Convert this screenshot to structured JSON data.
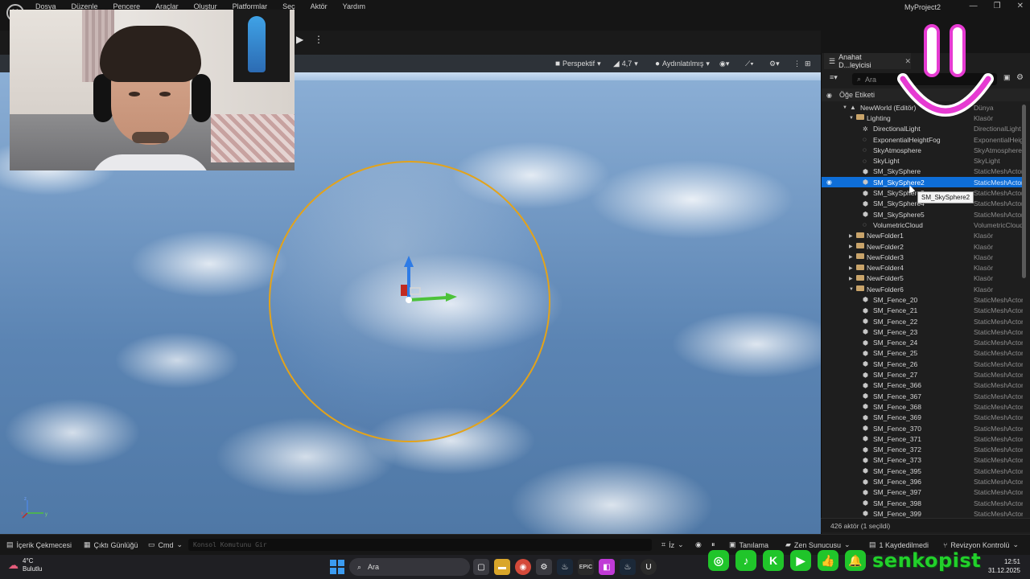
{
  "menubar": {
    "items": [
      "Dosya",
      "Düzenle",
      "Pencere",
      "Araçlar",
      "Oluştur",
      "Platformlar",
      "Seç",
      "Aktör",
      "Yardım"
    ],
    "project_name": "MyProject2"
  },
  "viewport": {
    "perspective_label": "Perspektif",
    "fov_value": "4,7",
    "lighting_label": "Aydınlatılmış",
    "axis_labels": [
      "z",
      "x",
      "y"
    ]
  },
  "outliner": {
    "tab_label": "Anahat D...leyicisi",
    "search_placeholder": "Ara",
    "header_label": "Öğe Etiketi",
    "rows": [
      {
        "label": "NewWorld (Editör)",
        "type": "Dünya",
        "depth": 0,
        "kind": "world",
        "expanded": true
      },
      {
        "label": "Lighting",
        "type": "Klasör",
        "depth": 1,
        "kind": "folder",
        "expanded": true
      },
      {
        "label": "DirectionalLight",
        "type": "DirectionalLight",
        "depth": 2,
        "kind": "light"
      },
      {
        "label": "ExponentialHeightFog",
        "type": "ExponentialHeightFog",
        "depth": 2,
        "kind": "actor"
      },
      {
        "label": "SkyAtmosphere",
        "type": "SkyAtmosphere",
        "depth": 2,
        "kind": "actor"
      },
      {
        "label": "SkyLight",
        "type": "SkyLight",
        "depth": 2,
        "kind": "actor"
      },
      {
        "label": "SM_SkySphere",
        "type": "StaticMeshActor",
        "depth": 2,
        "kind": "mesh"
      },
      {
        "label": "SM_SkySphere2",
        "type": "StaticMeshActor",
        "depth": 2,
        "kind": "mesh",
        "selected": true
      },
      {
        "label": "SM_SkySphere3",
        "type": "StaticMeshActor",
        "depth": 2,
        "kind": "mesh"
      },
      {
        "label": "SM_SkySphere4",
        "type": "StaticMeshActor",
        "depth": 2,
        "kind": "mesh"
      },
      {
        "label": "SM_SkySphere5",
        "type": "StaticMeshActor",
        "depth": 2,
        "kind": "mesh"
      },
      {
        "label": "VolumetricCloud",
        "type": "VolumetricCloud",
        "depth": 2,
        "kind": "actor"
      },
      {
        "label": "NewFolder1",
        "type": "Klasör",
        "depth": 1,
        "kind": "folder"
      },
      {
        "label": "NewFolder2",
        "type": "Klasör",
        "depth": 1,
        "kind": "folder"
      },
      {
        "label": "NewFolder3",
        "type": "Klasör",
        "depth": 1,
        "kind": "folder"
      },
      {
        "label": "NewFolder4",
        "type": "Klasör",
        "depth": 1,
        "kind": "folder"
      },
      {
        "label": "NewFolder5",
        "type": "Klasör",
        "depth": 1,
        "kind": "folder"
      },
      {
        "label": "NewFolder6",
        "type": "Klasör",
        "depth": 1,
        "kind": "folder",
        "expanded": true
      },
      {
        "label": "SM_Fence_20",
        "type": "StaticMeshActor",
        "depth": 2,
        "kind": "mesh"
      },
      {
        "label": "SM_Fence_21",
        "type": "StaticMeshActor",
        "depth": 2,
        "kind": "mesh"
      },
      {
        "label": "SM_Fence_22",
        "type": "StaticMeshActor",
        "depth": 2,
        "kind": "mesh"
      },
      {
        "label": "SM_Fence_23",
        "type": "StaticMeshActor",
        "depth": 2,
        "kind": "mesh"
      },
      {
        "label": "SM_Fence_24",
        "type": "StaticMeshActor",
        "depth": 2,
        "kind": "mesh"
      },
      {
        "label": "SM_Fence_25",
        "type": "StaticMeshActor",
        "depth": 2,
        "kind": "mesh"
      },
      {
        "label": "SM_Fence_26",
        "type": "StaticMeshActor",
        "depth": 2,
        "kind": "mesh"
      },
      {
        "label": "SM_Fence_27",
        "type": "StaticMeshActor",
        "depth": 2,
        "kind": "mesh"
      },
      {
        "label": "SM_Fence_366",
        "type": "StaticMeshActor",
        "depth": 2,
        "kind": "mesh"
      },
      {
        "label": "SM_Fence_367",
        "type": "StaticMeshActor",
        "depth": 2,
        "kind": "mesh"
      },
      {
        "label": "SM_Fence_368",
        "type": "StaticMeshActor",
        "depth": 2,
        "kind": "mesh"
      },
      {
        "label": "SM_Fence_369",
        "type": "StaticMeshActor",
        "depth": 2,
        "kind": "mesh"
      },
      {
        "label": "SM_Fence_370",
        "type": "StaticMeshActor",
        "depth": 2,
        "kind": "mesh"
      },
      {
        "label": "SM_Fence_371",
        "type": "StaticMeshActor",
        "depth": 2,
        "kind": "mesh"
      },
      {
        "label": "SM_Fence_372",
        "type": "StaticMeshActor",
        "depth": 2,
        "kind": "mesh"
      },
      {
        "label": "SM_Fence_373",
        "type": "StaticMeshActor",
        "depth": 2,
        "kind": "mesh"
      },
      {
        "label": "SM_Fence_395",
        "type": "StaticMeshActor",
        "depth": 2,
        "kind": "mesh"
      },
      {
        "label": "SM_Fence_396",
        "type": "StaticMeshActor",
        "depth": 2,
        "kind": "mesh"
      },
      {
        "label": "SM_Fence_397",
        "type": "StaticMeshActor",
        "depth": 2,
        "kind": "mesh"
      },
      {
        "label": "SM_Fence_398",
        "type": "StaticMeshActor",
        "depth": 2,
        "kind": "mesh"
      },
      {
        "label": "SM_Fence_399",
        "type": "StaticMeshActor",
        "depth": 2,
        "kind": "mesh"
      }
    ],
    "tooltip": "SM_SkySphere2",
    "footer": "426 aktör (1 seçildi)"
  },
  "statusbar": {
    "content_drawer": "İçerik Çekmecesi",
    "output_log": "Çıktı Günlüğü",
    "cmd_label": "Cmd",
    "cmd_placeholder": "Konsol Komutunu Gir",
    "trace_label": "İz",
    "tanimlama": "Tanılama",
    "zen": "Zen Sunucusu",
    "unsaved": "1 Kaydedilmedi",
    "revision": "Revizyon Kontrolü"
  },
  "taskbar": {
    "temperature": "4°C",
    "weather": "Bulutlu",
    "search": "Ara",
    "time": "12:51",
    "date": "31.12.2025"
  },
  "overlay": {
    "brand": "senkopist"
  },
  "colors": {
    "selection": "#0e6ed8",
    "sphere_ring": "#e3a31a",
    "brand_green": "#22d02b",
    "smiley_pink": "#e63ad2"
  }
}
